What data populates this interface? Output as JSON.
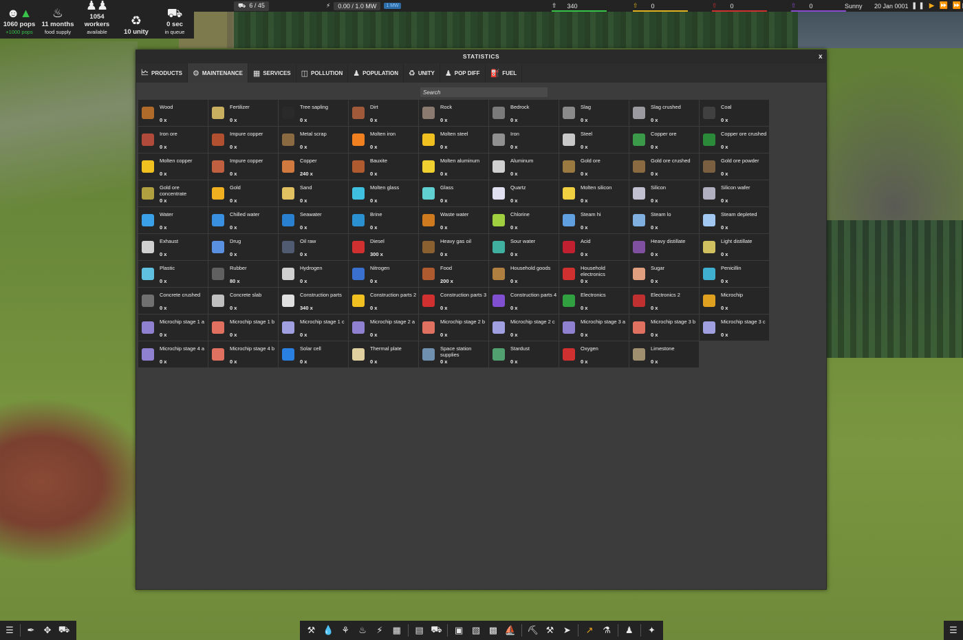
{
  "hud": {
    "population": {
      "value": "1060 pops",
      "sub": "+1000 pops",
      "icon": "population-icon"
    },
    "food": {
      "value": "11 months",
      "sub": "food supply",
      "icon": "food-bowl-icon"
    },
    "workers": {
      "value": "1054 workers",
      "sub": "available",
      "icon": "workers-icon"
    },
    "unity": {
      "value": "10 unity",
      "sub": "",
      "icon": "unity-icon"
    },
    "queue": {
      "value": "0 sec",
      "sub": "in queue",
      "icon": "truck-icon"
    }
  },
  "topbar": {
    "vehicles": "6 / 45",
    "power": "0.00 / 1.0 MW",
    "power_tag": "1 MW",
    "res1": "340",
    "res2": "0",
    "res3": "0",
    "res4": "0",
    "weather": "Sunny",
    "date": "20 Jan 0001",
    "colors": {
      "res1": "#38c24a",
      "res2": "#e0b020",
      "res3": "#d03030",
      "res4": "#8a4ad0"
    }
  },
  "window": {
    "title": "STATISTICS",
    "close": "x",
    "tabs": [
      {
        "label": "PRODUCTS",
        "icon": "chart-icon"
      },
      {
        "label": "MAINTENANCE",
        "icon": "gears-icon"
      },
      {
        "label": "SERVICES",
        "icon": "services-icon"
      },
      {
        "label": "POLLUTION",
        "icon": "trash-icon"
      },
      {
        "label": "POPULATION",
        "icon": "person-icon"
      },
      {
        "label": "UNITY",
        "icon": "unity-icon"
      },
      {
        "label": "POP DIFF",
        "icon": "person-icon"
      },
      {
        "label": "FUEL",
        "icon": "fuel-icon"
      }
    ],
    "search_placeholder": "Search"
  },
  "products": [
    {
      "name": "Wood",
      "count": "0 x",
      "color": "#b06a2a"
    },
    {
      "name": "Fertilizer",
      "count": "0 x",
      "color": "#c8b060"
    },
    {
      "name": "Tree sapling",
      "count": "0 x",
      "color": "#2a2a2a"
    },
    {
      "name": "Dirt",
      "count": "0 x",
      "color": "#a05a3a"
    },
    {
      "name": "Rock",
      "count": "0 x",
      "color": "#8a7a70"
    },
    {
      "name": "Bedrock",
      "count": "0 x",
      "color": "#7a7a7a"
    },
    {
      "name": "Slag",
      "count": "0 x",
      "color": "#8a8a8a"
    },
    {
      "name": "Slag crushed",
      "count": "0 x",
      "color": "#9a9aa0"
    },
    {
      "name": "Coal",
      "count": "0 x",
      "color": "#404040"
    },
    {
      "name": "Iron ore",
      "count": "0 x",
      "color": "#b04a3a"
    },
    {
      "name": "Impure copper",
      "count": "0 x",
      "color": "#b05030"
    },
    {
      "name": "Metal scrap",
      "count": "0 x",
      "color": "#8a6a40"
    },
    {
      "name": "Molten iron",
      "count": "0 x",
      "color": "#f08020"
    },
    {
      "name": "Molten steel",
      "count": "0 x",
      "color": "#f0c020"
    },
    {
      "name": "Iron",
      "count": "0 x",
      "color": "#909090"
    },
    {
      "name": "Steel",
      "count": "0 x",
      "color": "#c8c8c8"
    },
    {
      "name": "Copper ore",
      "count": "0 x",
      "color": "#3a9a4a"
    },
    {
      "name": "Copper ore crushed",
      "count": "0 x",
      "color": "#2a8a3a"
    },
    {
      "name": "Molten copper",
      "count": "0 x",
      "color": "#f0c020"
    },
    {
      "name": "Impure copper",
      "count": "0 x",
      "color": "#c06040"
    },
    {
      "name": "Copper",
      "count": "240 x",
      "color": "#d07a40"
    },
    {
      "name": "Bauxite",
      "count": "0 x",
      "color": "#b05a30"
    },
    {
      "name": "Molten aluminum",
      "count": "0 x",
      "color": "#f0d030"
    },
    {
      "name": "Aluminum",
      "count": "0 x",
      "color": "#d0d0d0"
    },
    {
      "name": "Gold ore",
      "count": "0 x",
      "color": "#9a7a40"
    },
    {
      "name": "Gold ore crushed",
      "count": "0 x",
      "color": "#8a6a40"
    },
    {
      "name": "Gold ore powder",
      "count": "0 x",
      "color": "#7a6040"
    },
    {
      "name": "Gold ore concentrate",
      "count": "0 x",
      "color": "#b0a040"
    },
    {
      "name": "Gold",
      "count": "0 x",
      "color": "#f0b020"
    },
    {
      "name": "Sand",
      "count": "0 x",
      "color": "#e0c060"
    },
    {
      "name": "Molten glass",
      "count": "0 x",
      "color": "#40c0e0"
    },
    {
      "name": "Glass",
      "count": "0 x",
      "color": "#60d0d0"
    },
    {
      "name": "Quartz",
      "count": "0 x",
      "color": "#e0e0f0"
    },
    {
      "name": "Molten silicon",
      "count": "0 x",
      "color": "#f0d040"
    },
    {
      "name": "Silicon",
      "count": "0 x",
      "color": "#c0c0d0"
    },
    {
      "name": "Silicon wafer",
      "count": "0 x",
      "color": "#b0b0c0"
    },
    {
      "name": "Water",
      "count": "0 x",
      "color": "#3aa0e8"
    },
    {
      "name": "Chilled water",
      "count": "0 x",
      "color": "#3a90e0"
    },
    {
      "name": "Seawater",
      "count": "0 x",
      "color": "#2a80d0"
    },
    {
      "name": "Brine",
      "count": "0 x",
      "color": "#2a90d0"
    },
    {
      "name": "Waste water",
      "count": "0 x",
      "color": "#d07a20"
    },
    {
      "name": "Chlorine",
      "count": "0 x",
      "color": "#a0d040"
    },
    {
      "name": "Steam hi",
      "count": "0 x",
      "color": "#60a0e0"
    },
    {
      "name": "Steam lo",
      "count": "0 x",
      "color": "#80b0e0"
    },
    {
      "name": "Steam depleted",
      "count": "0 x",
      "color": "#a0c8f0"
    },
    {
      "name": "Exhaust",
      "count": "0 x",
      "color": "#d0d0d0"
    },
    {
      "name": "Drug",
      "count": "0 x",
      "color": "#5a90e0"
    },
    {
      "name": "Oil raw",
      "count": "0 x",
      "color": "#505a70"
    },
    {
      "name": "Diesel",
      "count": "300 x",
      "color": "#d03030"
    },
    {
      "name": "Heavy gas oil",
      "count": "0 x",
      "color": "#8a6030"
    },
    {
      "name": "Sour water",
      "count": "0 x",
      "color": "#40b0a0"
    },
    {
      "name": "Acid",
      "count": "0 x",
      "color": "#c02030"
    },
    {
      "name": "Heavy distillate",
      "count": "0 x",
      "color": "#8050a0"
    },
    {
      "name": "Light distillate",
      "count": "0 x",
      "color": "#d0c060"
    },
    {
      "name": "Plastic",
      "count": "0 x",
      "color": "#60c0e0"
    },
    {
      "name": "Rubber",
      "count": "80 x",
      "color": "#606060"
    },
    {
      "name": "Hydrogen",
      "count": "0 x",
      "color": "#d0d0d0"
    },
    {
      "name": "Nitrogen",
      "count": "0 x",
      "color": "#3a70d0"
    },
    {
      "name": "Food",
      "count": "200 x",
      "color": "#b05a30"
    },
    {
      "name": "Household goods",
      "count": "0 x",
      "color": "#b08040"
    },
    {
      "name": "Household electronics",
      "count": "0 x",
      "color": "#d03030"
    },
    {
      "name": "Sugar",
      "count": "0 x",
      "color": "#e0a080"
    },
    {
      "name": "Penicillin",
      "count": "0 x",
      "color": "#40b0d0"
    },
    {
      "name": "Concrete crushed",
      "count": "0 x",
      "color": "#707070"
    },
    {
      "name": "Concrete slab",
      "count": "0 x",
      "color": "#c0c0c0"
    },
    {
      "name": "Construction parts",
      "count": "340 x",
      "color": "#e0e0e0"
    },
    {
      "name": "Construction parts 2",
      "count": "0 x",
      "color": "#f0c020"
    },
    {
      "name": "Construction parts 3",
      "count": "0 x",
      "color": "#d03030"
    },
    {
      "name": "Construction parts 4",
      "count": "0 x",
      "color": "#8050d0"
    },
    {
      "name": "Electronics",
      "count": "0 x",
      "color": "#30a040"
    },
    {
      "name": "Electronics 2",
      "count": "0 x",
      "color": "#c03030"
    },
    {
      "name": "Microchip",
      "count": "0 x",
      "color": "#e0a020"
    },
    {
      "name": "Microchip stage 1 a",
      "count": "0 x",
      "color": "#9080d0"
    },
    {
      "name": "Microchip stage 1 b",
      "count": "0 x",
      "color": "#e07060"
    },
    {
      "name": "Microchip stage 1 c",
      "count": "0 x",
      "color": "#a0a0e0"
    },
    {
      "name": "Microchip stage 2 a",
      "count": "0 x",
      "color": "#9080d0"
    },
    {
      "name": "Microchip stage 2 b",
      "count": "0 x",
      "color": "#e07060"
    },
    {
      "name": "Microchip stage 2 c",
      "count": "0 x",
      "color": "#a0a0e0"
    },
    {
      "name": "Microchip stage 3 a",
      "count": "0 x",
      "color": "#9080d0"
    },
    {
      "name": "Microchip stage 3 b",
      "count": "0 x",
      "color": "#e07060"
    },
    {
      "name": "Microchip stage 3 c",
      "count": "0 x",
      "color": "#a0a0e0"
    },
    {
      "name": "Microchip stage 4 a",
      "count": "0 x",
      "color": "#9080d0"
    },
    {
      "name": "Microchip stage 4 b",
      "count": "0 x",
      "color": "#e07060"
    },
    {
      "name": "Solar cell",
      "count": "0 x",
      "color": "#2a80e0"
    },
    {
      "name": "Thermal plate",
      "count": "0 x",
      "color": "#e0d0a0"
    },
    {
      "name": "Space station supplies",
      "count": "0 x",
      "color": "#7090b0"
    },
    {
      "name": "Stardust",
      "count": "0 x",
      "color": "#50a070"
    },
    {
      "name": "Oxygen",
      "count": "0 x",
      "color": "#d03030"
    },
    {
      "name": "Limestone",
      "count": "0 x",
      "color": "#a09070"
    }
  ],
  "bottom": {
    "left_tools": [
      "layers-icon",
      "eyedropper-icon",
      "move-icon",
      "bulldozer-icon"
    ],
    "mid_tools": [
      "crane-icon",
      "water-drop-icon",
      "farm-icon",
      "fire-icon",
      "power-icon",
      "container-icon",
      "conveyor-icon",
      "vehicle-icon",
      "factory-icon",
      "industry-icon",
      "building-icon",
      "ship-icon",
      "excavator-icon",
      "miner-icon",
      "rocket-icon",
      "statistics-icon",
      "research-icon",
      "people-icon",
      "satellite-icon"
    ],
    "menu": "menu-icon"
  }
}
